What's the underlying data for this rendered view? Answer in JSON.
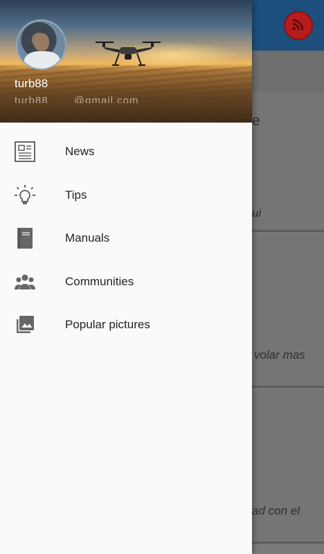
{
  "drawer": {
    "username": "turb88",
    "email": "turb88____@gmail.com",
    "items": [
      {
        "label": "News",
        "icon": "newspaper-icon"
      },
      {
        "label": "Tips",
        "icon": "lightbulb-icon"
      },
      {
        "label": "Manuals",
        "icon": "book-icon"
      },
      {
        "label": "Communities",
        "icon": "group-icon"
      },
      {
        "label": "Popular pictures",
        "icon": "photo-library-icon"
      }
    ]
  },
  "background": {
    "appbar_color": "#1d4f7c",
    "rss_icon": "rss-feed-icon",
    "card_fragments": [
      "e",
      "ui",
      "volar mas",
      "ad con el"
    ]
  }
}
